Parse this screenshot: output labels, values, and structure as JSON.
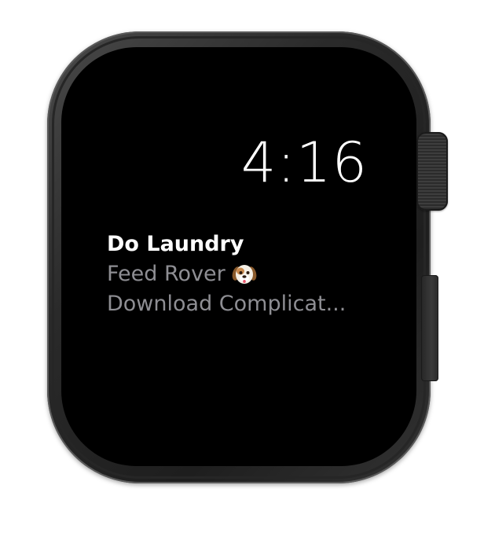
{
  "watch": {
    "time": "4:16",
    "tasks": [
      {
        "label": "Do Laundry",
        "style": "primary"
      },
      {
        "label": "Feed Rover",
        "style": "secondary",
        "icon": "dog-face-icon"
      },
      {
        "label": "Download Complicat...",
        "style": "secondary"
      }
    ]
  },
  "colors": {
    "screen_bg": "#000000",
    "primary_text": "#ffffff",
    "secondary_text": "#8e8e93",
    "case": "#2a2a2a"
  }
}
